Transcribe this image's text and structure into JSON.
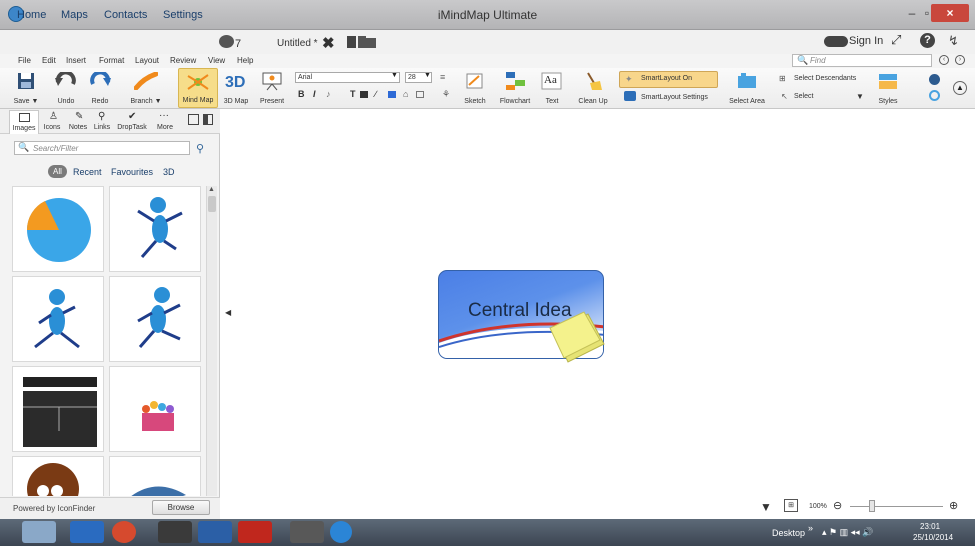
{
  "window": {
    "title": "iMindMap Ultimate",
    "min": "–",
    "max": "▫",
    "close": "×"
  },
  "menubar": {
    "tabs": [
      "Home",
      "Maps",
      "Contacts",
      "Settings"
    ],
    "notification_count": "7",
    "document_tab": "Untitled *",
    "doc_close": "✖",
    "sign_in": "Sign In",
    "help": "?"
  },
  "submenu": {
    "items": [
      "File",
      "Edit",
      "Insert",
      "Format",
      "Layout",
      "Review",
      "View",
      "Help"
    ],
    "find_placeholder": "Find"
  },
  "ribbon": {
    "save": "Save ▼",
    "undo": "Undo",
    "redo": "Redo",
    "branch": "Branch ▼",
    "mindmap": "Mind Map",
    "map3d": "3D Map",
    "present": "Present",
    "font": "Arial",
    "size": "28",
    "bold": "B",
    "italic": "I",
    "sketch": "Sketch",
    "flowchart": "Flowchart",
    "text": "Text",
    "cleanup": "Clean Up",
    "smartlayout_on": "SmartLayout On",
    "smartlayout_settings": "SmartLayout Settings",
    "select_area": "Select Area",
    "select_descendants": "Select Descendants",
    "select": "Select",
    "styles": "Styles",
    "text_icon": "Aa",
    "t_icon": "T"
  },
  "panel": {
    "tabs": [
      "Images",
      "Icons",
      "Notes",
      "Links",
      "DropTask",
      "More"
    ],
    "search_placeholder": "Search/Filter",
    "filters": [
      "All",
      "Recent",
      "Favourites",
      "3D"
    ],
    "powered_by": "Powered by IconFinder",
    "browse": "Browse"
  },
  "canvas": {
    "central_idea": "Central Idea"
  },
  "zoom": {
    "value": "100%",
    "percent": 100
  },
  "taskbar": {
    "desktop": "Desktop",
    "chevron": "»",
    "time": "23:01",
    "date": "25/10/2014"
  },
  "colors": {
    "accent": "#4b7fe6",
    "highlight": "#f6dd8a"
  }
}
